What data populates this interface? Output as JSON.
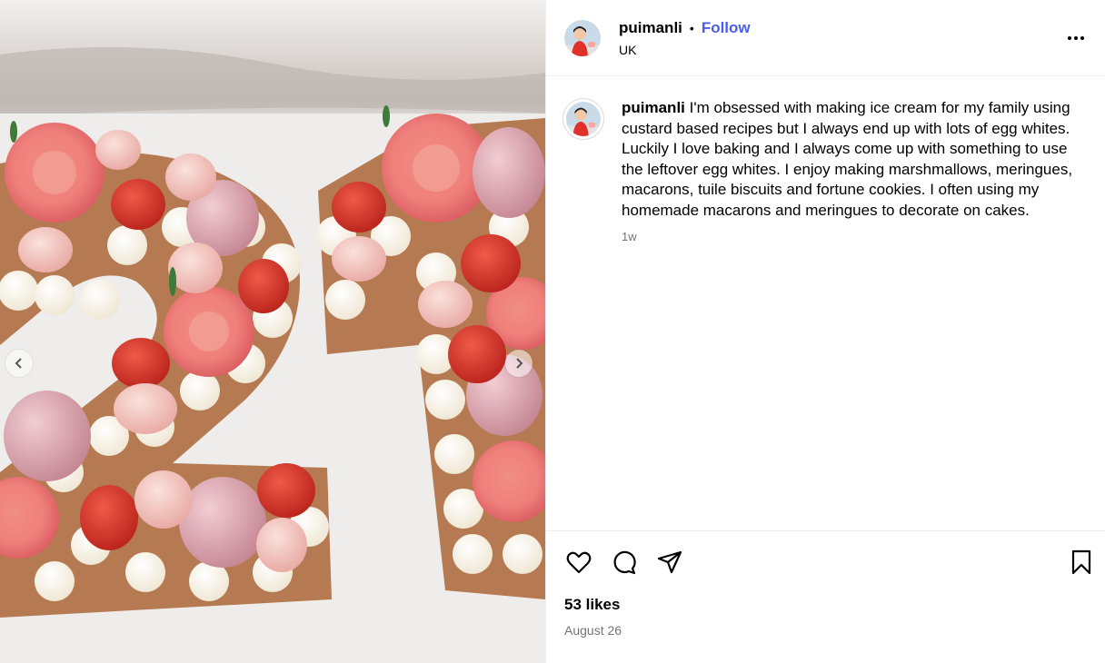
{
  "author": {
    "username": "puimanli",
    "separator": "•",
    "follow_label": "Follow",
    "location": "UK"
  },
  "caption": {
    "username": "puimanli",
    "text": "I'm obsessed with making ice cream for my family using custard based recipes but I always end up with lots of egg whites. Luckily I love baking and I always come up with something to use the leftover egg whites. I enjoy making marshmallows, meringues, macarons, tuile biscuits and fortune cookies. I often using my homemade macarons and meringues to decorate on cakes.",
    "time": "1w"
  },
  "engagement": {
    "likes": "53 likes",
    "date": "August 26"
  },
  "icons": {
    "more": "more-options-icon",
    "like": "heart-icon",
    "comment": "comment-icon",
    "share": "share-icon",
    "save": "bookmark-icon",
    "prev": "chevron-left-icon",
    "next": "chevron-right-icon"
  },
  "colors": {
    "follow": "#4a5df0",
    "muted": "#737373",
    "divider": "#efefef"
  }
}
